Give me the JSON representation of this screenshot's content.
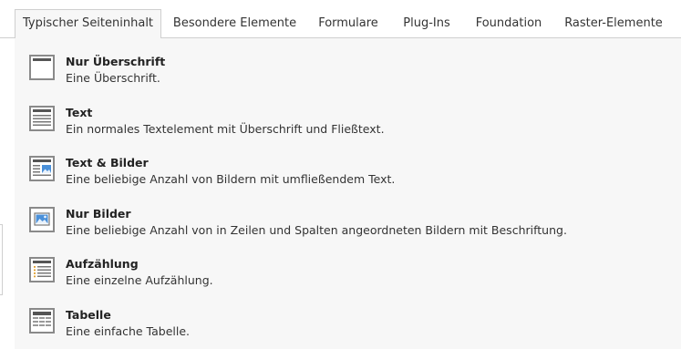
{
  "tabs": [
    {
      "label": "Typischer Seiteninhalt",
      "active": true
    },
    {
      "label": "Besondere Elemente"
    },
    {
      "label": "Formulare"
    },
    {
      "label": "Plug-Ins"
    },
    {
      "label": "Foundation"
    },
    {
      "label": "Raster-Elemente"
    }
  ],
  "items": [
    {
      "title": "Nur Überschrift",
      "desc": "Eine Überschrift.",
      "icon": "header-icon"
    },
    {
      "title": "Text",
      "desc": "Ein normales Textelement mit Überschrift und Fließtext.",
      "icon": "text-icon"
    },
    {
      "title": "Text & Bilder",
      "desc": "Eine beliebige Anzahl von Bildern mit umfließendem Text.",
      "icon": "text-image-icon"
    },
    {
      "title": "Nur Bilder",
      "desc": "Eine beliebige Anzahl von in Zeilen und Spalten angeordneten Bildern mit Beschriftung.",
      "icon": "image-icon"
    },
    {
      "title": "Aufzählung",
      "desc": "Eine einzelne Aufzählung.",
      "icon": "bullet-list-icon"
    },
    {
      "title": "Tabelle",
      "desc": "Eine einfache Tabelle.",
      "icon": "table-icon"
    }
  ],
  "colors": {
    "accent": "#4a90d9",
    "icon_border": "#8a8a8a",
    "panel_bg": "#f7f7f7"
  }
}
